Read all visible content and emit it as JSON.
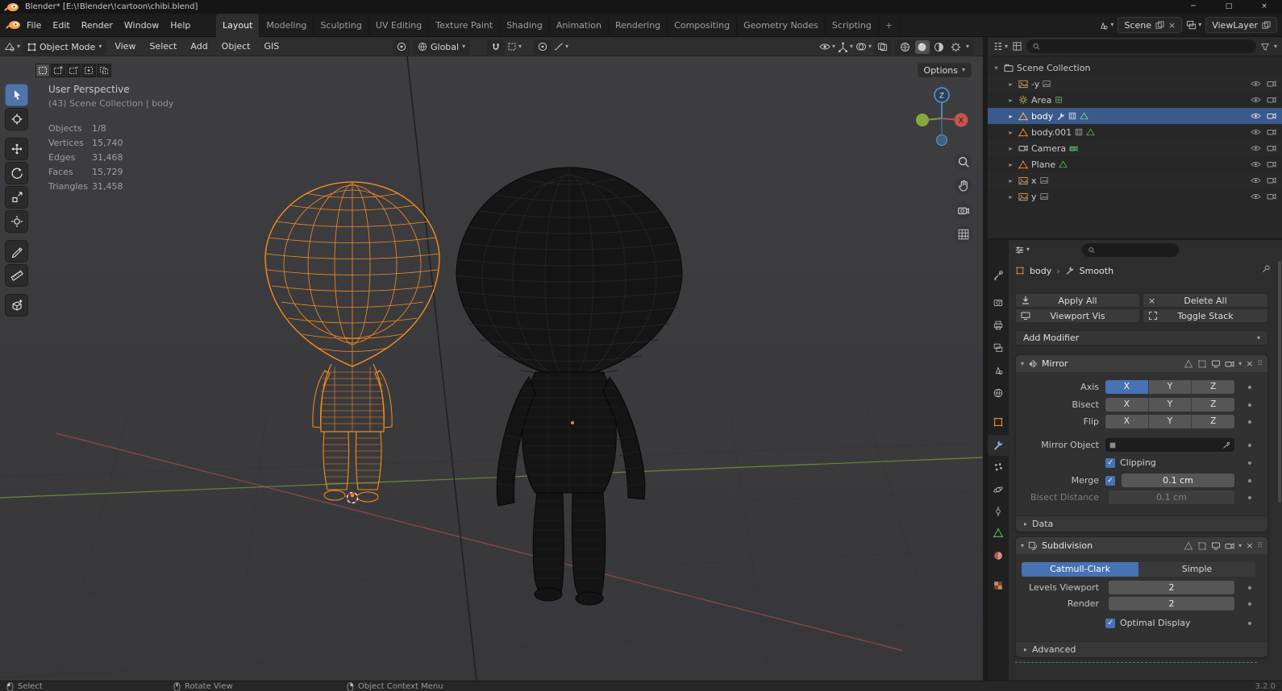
{
  "icons": {
    "check": "✓",
    "chevron_down": "▾",
    "chevron_right": "▸",
    "close": "×",
    "minimize": "─",
    "maximize": "□",
    "drag": "⠿",
    "separator": "›",
    "add": "+"
  },
  "window": {
    "title": "Blender* [E:\\!Blender\\!cartoon\\chibi.blend]"
  },
  "topbar": {
    "menus": [
      "File",
      "Edit",
      "Render",
      "Window",
      "Help"
    ],
    "workspaces": [
      "Layout",
      "Modeling",
      "Sculpting",
      "UV Editing",
      "Texture Paint",
      "Shading",
      "Animation",
      "Rendering",
      "Compositing",
      "Geometry Nodes",
      "Scripting"
    ],
    "active_workspace": "Layout",
    "scene": {
      "label": "Scene"
    },
    "view_layer": {
      "label": "ViewLayer"
    }
  },
  "tool_header": {
    "mode": "Object Mode",
    "menus": [
      "View",
      "Select",
      "Add",
      "Object",
      "GIS"
    ],
    "orientation": "Global"
  },
  "viewport": {
    "options_label": "Options",
    "perspective_label": "User Perspective",
    "context_label": "(43) Scene Collection | body",
    "stats": [
      {
        "label": "Objects",
        "value": "1/8"
      },
      {
        "label": "Vertices",
        "value": "15,740"
      },
      {
        "label": "Edges",
        "value": "31,468"
      },
      {
        "label": "Faces",
        "value": "15,729"
      },
      {
        "label": "Triangles",
        "value": "31,458"
      }
    ],
    "gizmo": {
      "x": "X",
      "z": "Z"
    }
  },
  "outliner": {
    "root_label": "Scene Collection",
    "items": [
      {
        "name": "-y",
        "type": "image"
      },
      {
        "name": "Area",
        "type": "light"
      },
      {
        "name": "body",
        "type": "mesh",
        "selected": true
      },
      {
        "name": "body.001",
        "type": "mesh"
      },
      {
        "name": "Camera",
        "type": "camera"
      },
      {
        "name": "Plane",
        "type": "mesh"
      },
      {
        "name": "x",
        "type": "image"
      },
      {
        "name": "y",
        "type": "image"
      }
    ]
  },
  "properties": {
    "breadcrumb": {
      "object": "body",
      "modifier": "Smooth"
    },
    "actions": {
      "apply_all": "Apply All",
      "delete_all": "Delete All",
      "viewport_vis": "Viewport Vis",
      "toggle_stack": "Toggle Stack"
    },
    "add_modifier_label": "Add Modifier",
    "mirror": {
      "name": "Mirror",
      "axis_label": "Axis",
      "bisect_label": "Bisect",
      "flip_label": "Flip",
      "axis_options": [
        "X",
        "Y",
        "Z"
      ],
      "active_axis": "X",
      "mirror_object_label": "Mirror Object",
      "clipping_label": "Clipping",
      "merge_label": "Merge",
      "merge_value": "0.1 cm",
      "bisect_distance_label": "Bisect Distance",
      "bisect_distance_value": "0.1 cm",
      "data_label": "Data"
    },
    "subdivision": {
      "name": "Subdivision",
      "algorithms": [
        "Catmull-Clark",
        "Simple"
      ],
      "active_algorithm": "Catmull-Clark",
      "levels_viewport_label": "Levels Viewport",
      "levels_viewport_value": "2",
      "render_label": "Render",
      "render_value": "2",
      "optimal_display_label": "Optimal Display",
      "advanced_label": "Advanced"
    }
  },
  "status_bar": {
    "select_label": "Select",
    "rotate_label": "Rotate View",
    "context_menu_label": "Object Context Menu",
    "version": "3.2.0"
  },
  "colors": {
    "accent_blue": "#4772b3",
    "selection_orange": "#f5870f",
    "selected_row": "#3a5a8c",
    "axis_x": "#c4554c",
    "axis_y": "#86a83e",
    "axis_z": "#5b96d8"
  }
}
